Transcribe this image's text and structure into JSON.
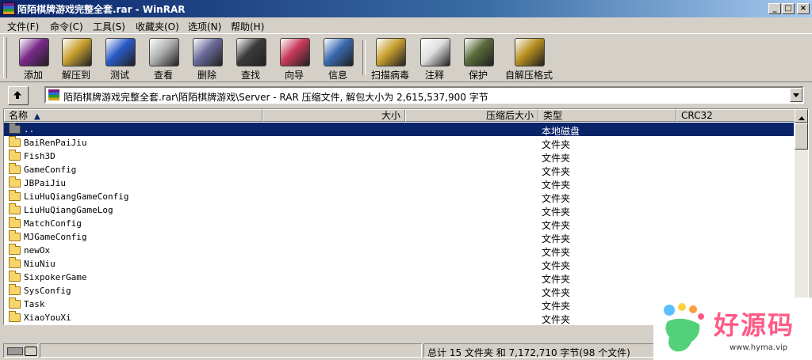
{
  "window": {
    "title": "陌陌棋牌游戏完整全套.rar - WinRAR",
    "controls": {
      "minimize": "_",
      "maximize": "□",
      "close": "×"
    }
  },
  "menu": [
    {
      "label": "文件(F)"
    },
    {
      "label": "命令(C)"
    },
    {
      "label": "工具(S)"
    },
    {
      "label": "收藏夹(O)"
    },
    {
      "label": "选项(N)"
    },
    {
      "label": "帮助(H)"
    }
  ],
  "toolbar": [
    {
      "label": "添加",
      "icon": "add-archive-icon",
      "color": "#7a2a8a"
    },
    {
      "label": "解压到",
      "icon": "extract-to-icon",
      "color": "#c8a030"
    },
    {
      "label": "测试",
      "icon": "test-icon",
      "color": "#2a5ac8"
    },
    {
      "label": "查看",
      "icon": "view-icon",
      "color": "#b0b0b0"
    },
    {
      "label": "删除",
      "icon": "delete-icon",
      "color": "#6a6a9a"
    },
    {
      "label": "查找",
      "icon": "find-icon",
      "color": "#3a3a3a"
    },
    {
      "label": "向导",
      "icon": "wizard-icon",
      "color": "#c83a5a"
    },
    {
      "label": "信息",
      "icon": "info-icon",
      "color": "#3a6ab0"
    },
    {
      "label": "扫描病毒",
      "icon": "virus-scan-icon",
      "color": "#c8a030"
    },
    {
      "label": "注释",
      "icon": "comment-icon",
      "color": "#e0e0e0"
    },
    {
      "label": "保护",
      "icon": "protect-icon",
      "color": "#5a6a3a"
    },
    {
      "label": "自解压格式",
      "icon": "sfx-icon",
      "color": "#b89020"
    }
  ],
  "address": {
    "path": "陌陌棋牌游戏完整全套.rar\\陌陌棋牌游戏\\Server - RAR 压缩文件, 解包大小为 2,615,537,900 字节"
  },
  "columns": {
    "name": "名称",
    "size": "大小",
    "packed": "压缩后大小",
    "type": "类型",
    "crc": "CRC32"
  },
  "rows": [
    {
      "name": "..",
      "type": "本地磁盘",
      "selected": true,
      "up": true
    },
    {
      "name": "BaiRenPaiJiu",
      "type": "文件夹"
    },
    {
      "name": "Fish3D",
      "type": "文件夹"
    },
    {
      "name": "GameConfig",
      "type": "文件夹"
    },
    {
      "name": "JBPaiJiu",
      "type": "文件夹"
    },
    {
      "name": "LiuHuQiangGameConfig",
      "type": "文件夹"
    },
    {
      "name": "LiuHuQiangGameLog",
      "type": "文件夹"
    },
    {
      "name": "MatchConfig",
      "type": "文件夹"
    },
    {
      "name": "MJGameConfig",
      "type": "文件夹"
    },
    {
      "name": "newOx",
      "type": "文件夹"
    },
    {
      "name": "NiuNiu",
      "type": "文件夹"
    },
    {
      "name": "SixpokerGame",
      "type": "文件夹"
    },
    {
      "name": "SysConfig",
      "type": "文件夹"
    },
    {
      "name": "Task",
      "type": "文件夹"
    },
    {
      "name": "XiaoYouXi",
      "type": "文件夹"
    }
  ],
  "status": {
    "summary": "总计 15 文件夹 和 7,172,710 字节(98 个文件)"
  },
  "watermark": {
    "text": "好源码",
    "url": "www.hyma.vip"
  }
}
